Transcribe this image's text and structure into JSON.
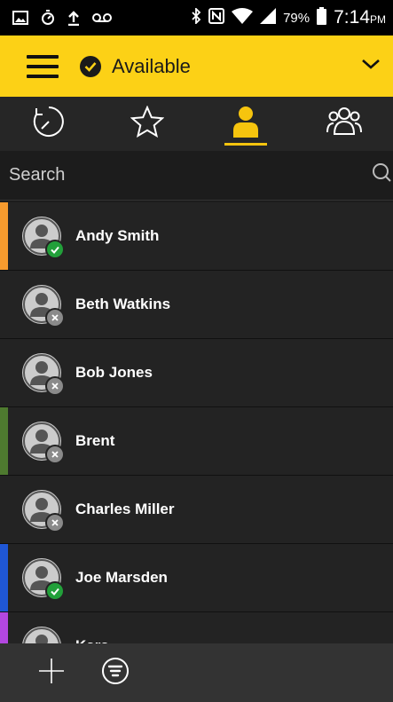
{
  "status_bar": {
    "battery_percent": "79%",
    "time": "7:14",
    "time_suffix": "PM"
  },
  "topbar": {
    "presence_label": "Available"
  },
  "tabs": [
    {
      "name": "recent",
      "icon": "history-icon",
      "active": false
    },
    {
      "name": "favorites",
      "icon": "star-icon",
      "active": false
    },
    {
      "name": "contacts",
      "icon": "person-icon",
      "active": true
    },
    {
      "name": "groups",
      "icon": "group-icon",
      "active": false
    }
  ],
  "search": {
    "placeholder": "Search"
  },
  "contacts": [
    {
      "name": "Andy Smith",
      "status": "available",
      "stripe": "#f79b2e"
    },
    {
      "name": "Beth Watkins",
      "status": "offline",
      "stripe": ""
    },
    {
      "name": "Bob Jones",
      "status": "offline",
      "stripe": ""
    },
    {
      "name": "Brent",
      "status": "offline",
      "stripe": "#4e7a2f"
    },
    {
      "name": "Charles Miller",
      "status": "offline",
      "stripe": ""
    },
    {
      "name": "Joe Marsden",
      "status": "available",
      "stripe": "#1f57d6"
    },
    {
      "name": "Kara",
      "status": "offline",
      "stripe": "#b347e0"
    }
  ],
  "colors": {
    "accent": "#fcd116",
    "active_tab": "#f6c40e",
    "available": "#22a03a"
  }
}
